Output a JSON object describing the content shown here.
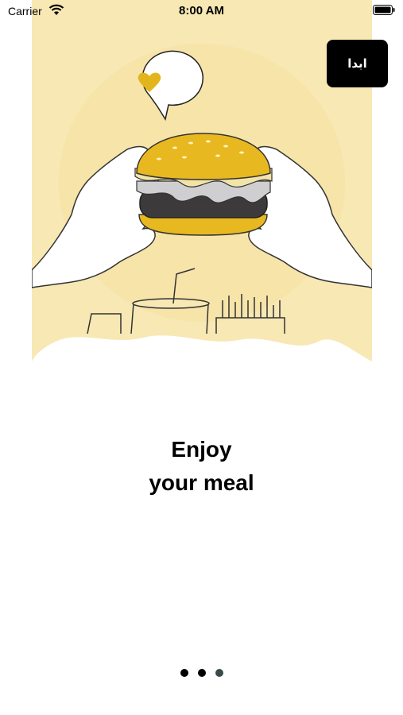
{
  "status_bar": {
    "carrier": "Carrier",
    "time": "8:00 AM"
  },
  "start_button": {
    "label": "ابدا"
  },
  "heading": {
    "line1": "Enjoy",
    "line2": "your meal"
  },
  "page_indicator": {
    "total": 3,
    "current": 3
  },
  "colors": {
    "illustration_bg": "#f7e8b4",
    "bun": "#e8b820",
    "heart": "#e3b51c",
    "button_bg": "#000000"
  },
  "icons": {
    "wifi": "wifi-icon",
    "battery": "battery-icon",
    "heart": "heart-icon"
  }
}
